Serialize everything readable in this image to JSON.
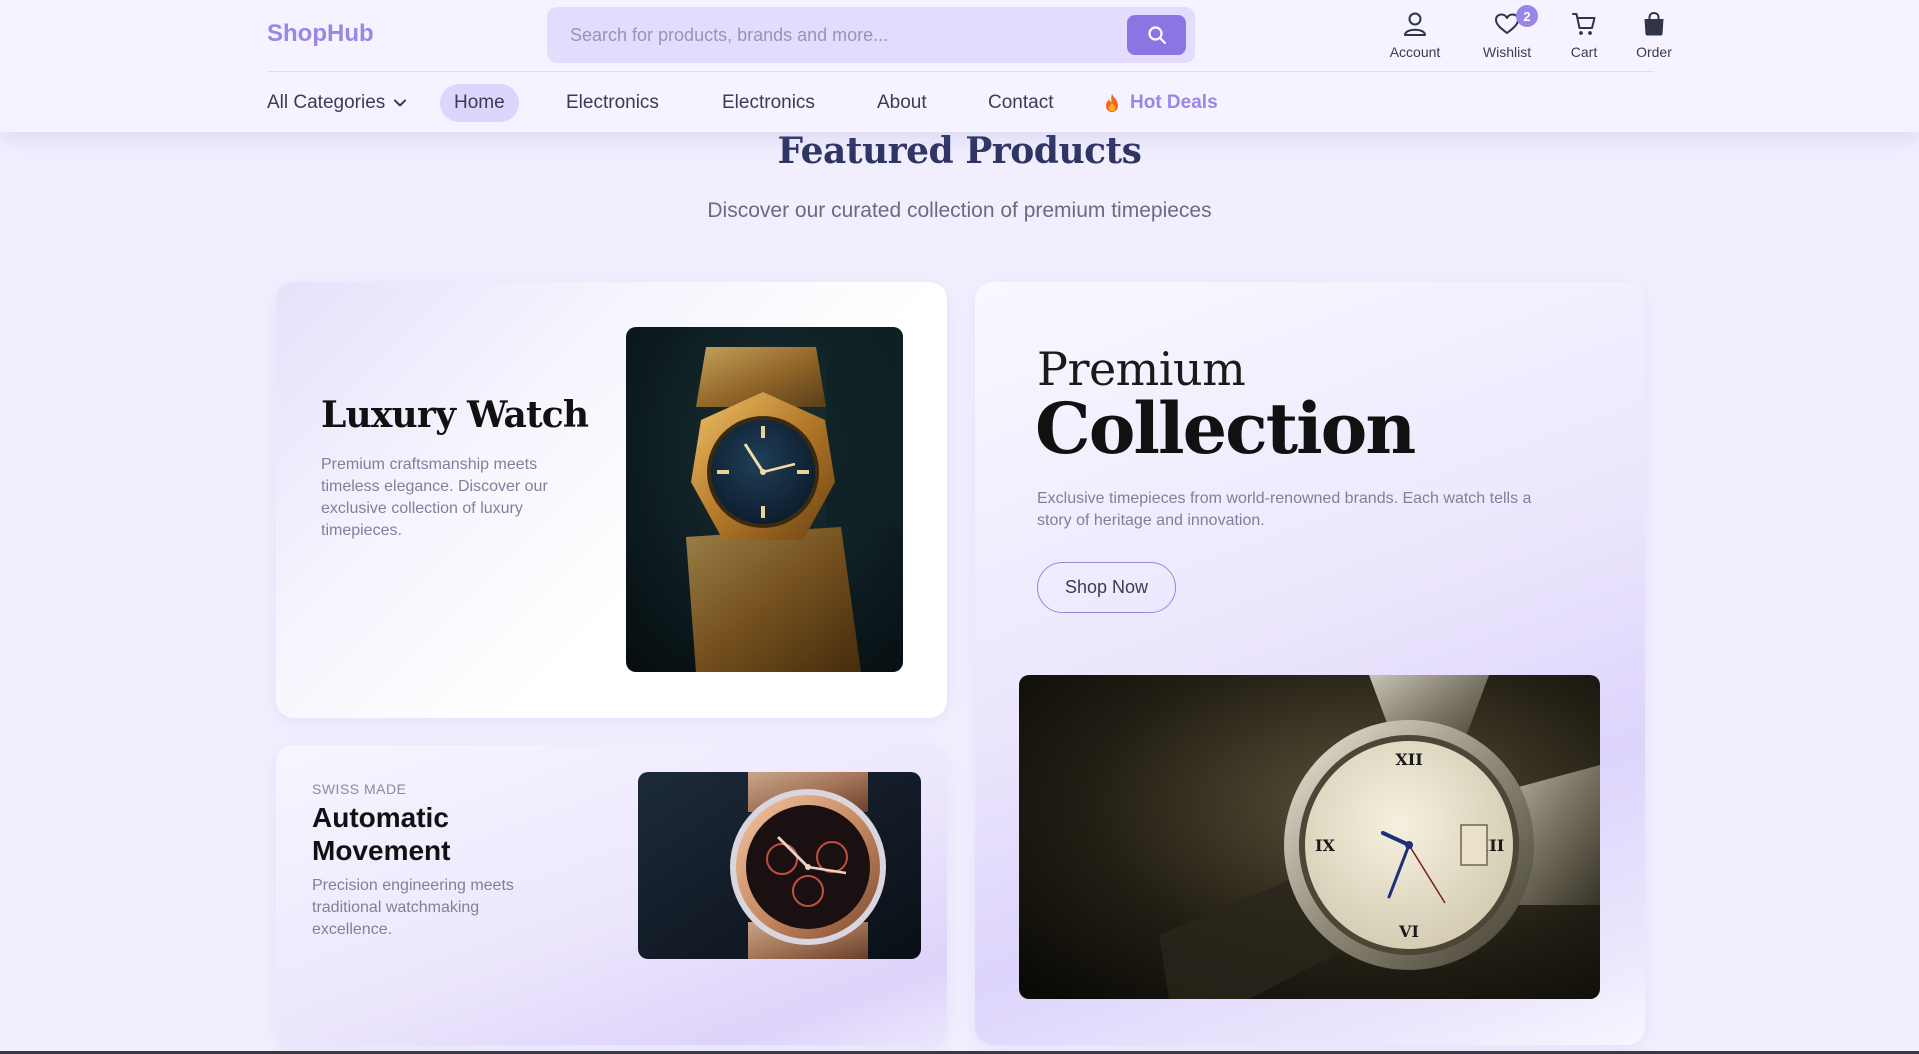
{
  "header": {
    "logo": "ShopHub",
    "search": {
      "placeholder": "Search for products, brands and more..."
    },
    "actions": [
      {
        "label": "Account",
        "icon": "user-icon"
      },
      {
        "label": "Wishlist",
        "icon": "heart-icon",
        "badge": "2"
      },
      {
        "label": "Cart",
        "icon": "cart-icon"
      },
      {
        "label": "Order",
        "icon": "bag-icon"
      }
    ]
  },
  "nav": {
    "all_categories": "All Categories",
    "items": [
      "Home",
      "Electronics",
      "Electronics",
      "About",
      "Contact"
    ],
    "hot_deals": "Hot Deals"
  },
  "section": {
    "title": "Featured Products",
    "subtitle": "Discover our curated collection of premium timepieces"
  },
  "cards": {
    "luxury": {
      "title": "Luxury Watch",
      "description": "Premium craftsmanship meets timeless elegance. Discover our exclusive collection of luxury timepieces."
    },
    "automatic": {
      "tag": "SWISS MADE",
      "title": "Automatic Movement",
      "description": "Precision engineering meets traditional watchmaking excellence."
    },
    "premium": {
      "pretitle": "Premium",
      "title": "Collection",
      "description": "Exclusive timepieces from world-renowned brands. Each watch tells a story of heritage and innovation.",
      "button": "Shop Now"
    }
  },
  "colors": {
    "accent": "#8c74e3",
    "logo": "#9b86e6",
    "background": "#f1effe",
    "title": "#2e3563"
  }
}
